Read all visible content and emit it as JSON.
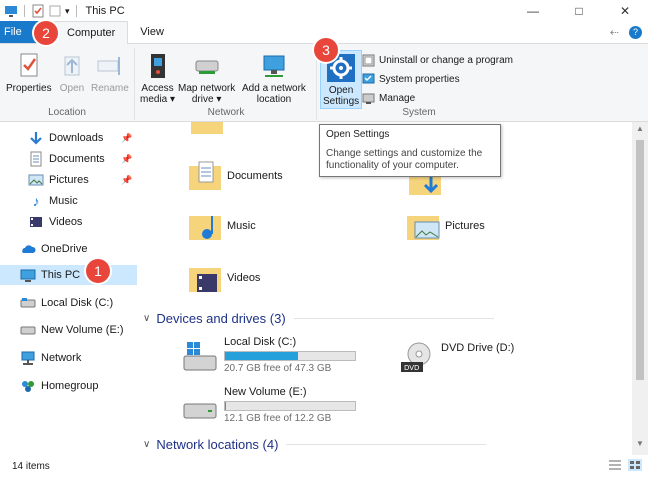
{
  "window": {
    "title": "This PC"
  },
  "tabs": [
    {
      "label": "File"
    },
    {
      "label": "Computer"
    },
    {
      "label": "View"
    }
  ],
  "ribbon": {
    "location": {
      "label": "Location",
      "properties": "Properties",
      "open": "Open",
      "rename": "Rename"
    },
    "network": {
      "label": "Network",
      "access_media": [
        "Access",
        "media ▾"
      ],
      "map_drive": [
        "Map network",
        "drive ▾"
      ],
      "add_location": [
        "Add a network",
        "location"
      ]
    },
    "system": {
      "label": "System",
      "open_settings": [
        "Open",
        "Settings"
      ],
      "uninstall": "Uninstall or change a program",
      "system_properties": "System properties",
      "manage": "Manage"
    }
  },
  "tooltip": {
    "title": "Open Settings",
    "body": "Change settings and customize the functionality of your computer."
  },
  "sidebar": {
    "items": [
      {
        "label": "Downloads",
        "icon": "download-arrow-icon",
        "pinned": true
      },
      {
        "label": "Documents",
        "icon": "document-icon",
        "pinned": true
      },
      {
        "label": "Pictures",
        "icon": "pictures-icon",
        "pinned": true
      },
      {
        "label": "Music",
        "icon": "music-note-icon",
        "pinned": false
      },
      {
        "label": "Videos",
        "icon": "video-icon",
        "pinned": false
      },
      {
        "label": "OneDrive",
        "icon": "cloud-icon",
        "pinned": false
      },
      {
        "label": "This PC",
        "icon": "computer-icon",
        "pinned": false,
        "selected": true
      },
      {
        "label": "Local Disk (C:)",
        "icon": "disk-icon",
        "pinned": false
      },
      {
        "label": "New Volume (E:)",
        "icon": "disk-icon",
        "pinned": false
      },
      {
        "label": "Network",
        "icon": "network-icon",
        "pinned": false
      },
      {
        "label": "Homegroup",
        "icon": "homegroup-icon",
        "pinned": false
      }
    ]
  },
  "folders": [
    {
      "label": "Documents"
    },
    {
      "label": "Music"
    },
    {
      "label": "Pictures"
    },
    {
      "label": "Videos"
    }
  ],
  "sections": {
    "devices": "Devices and drives (3)",
    "network": "Network locations (4)"
  },
  "drives": [
    {
      "name": "Local Disk (C:)",
      "free": "20.7 GB free of 47.3 GB",
      "used_fraction": 0.56
    },
    {
      "name": "New Volume (E:)",
      "free": "12.1 GB free of 12.2 GB",
      "used_fraction": 0.01
    },
    {
      "name": "DVD Drive (D:)"
    }
  ],
  "status": {
    "items": "14 items"
  },
  "callouts": [
    "1",
    "2",
    "3"
  ],
  "colors": {
    "accent": "#1979ca",
    "selection": "#cce8ff",
    "callout": "#e8463b",
    "bar_fill": "#26a0da"
  }
}
